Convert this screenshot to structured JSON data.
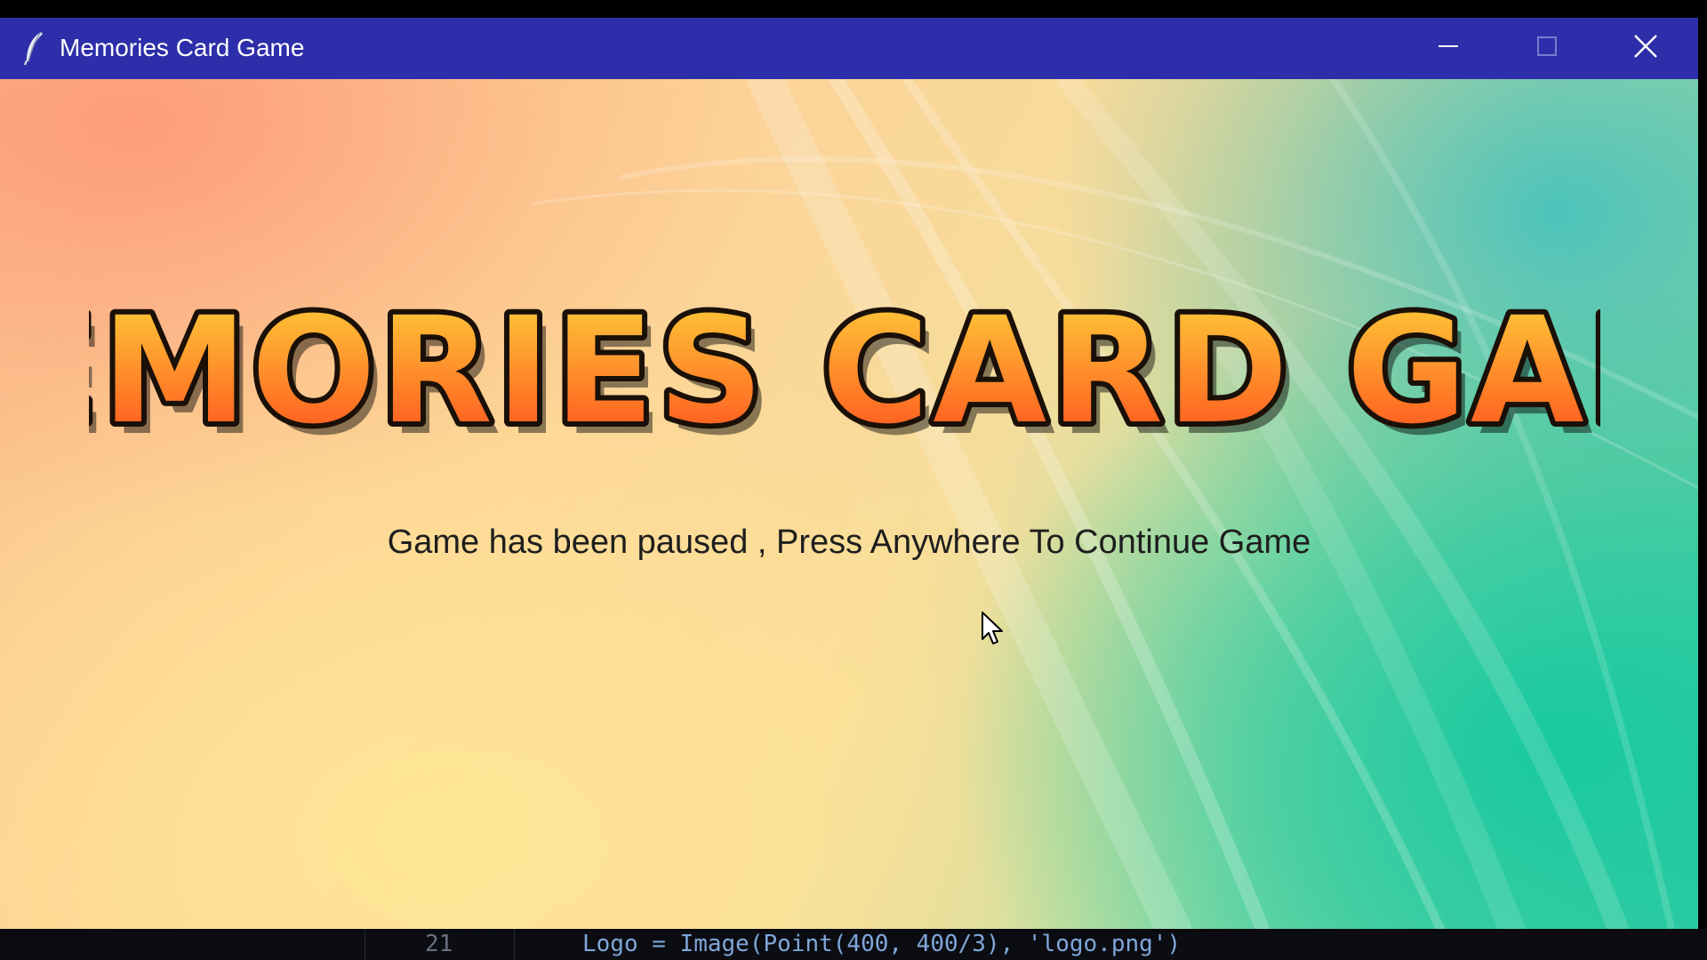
{
  "window": {
    "title": "Memories Card Game",
    "icon": "feather-icon",
    "controls": {
      "minimize": "minimize-icon",
      "maximize": "maximize-icon",
      "close": "close-icon"
    },
    "titlebar_color": "#2d2ea9"
  },
  "game": {
    "logo_text": "MEMORIES CARD GAME",
    "pause_message": "Game has been paused , Press Anywhere To Continue Game",
    "logo_colors": {
      "top": "#ffd43a",
      "bottom": "#ff4a1c",
      "outline": "#1a1008"
    }
  },
  "background_editor": {
    "line_number": "21",
    "code_line": "Logo = Image(Point(400, 400/3), 'logo.png')"
  }
}
